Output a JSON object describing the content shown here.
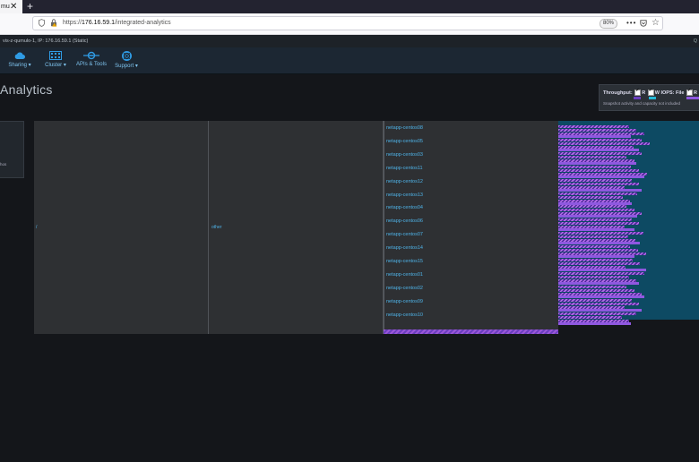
{
  "browser": {
    "tab_title": "mu",
    "close_glyph": "✕",
    "new_tab_glyph": "+",
    "url_prefix": "https://",
    "url_host": "176.16.59.1",
    "url_path": "/integrated-analytics",
    "zoom": "80%",
    "more_glyph": "•••",
    "star_glyph": "☆"
  },
  "status": {
    "host_info": "vis-z-qumulo-1, IP: 176.16.59.1 (Static)",
    "right_text": "Q"
  },
  "nav": [
    {
      "label": "Sharing ▾",
      "icon": "cloud-icon"
    },
    {
      "label": "Cluster ▾",
      "icon": "cluster-icon"
    },
    {
      "label": "APIs & Tools",
      "icon": "api-icon"
    },
    {
      "label": "Support ▾",
      "icon": "lifebuoy-icon"
    }
  ],
  "page_title": "Analytics",
  "legend": {
    "throughput_label": "Throughput:",
    "read_label": "R",
    "write_label": "W",
    "iops_label": "IOPS:",
    "file_label": "File",
    "r_label": "R",
    "note": "Snapshot activity and capacity not included",
    "colors": {
      "read": "#b36ee6",
      "write": "#8f58e0",
      "iops_cyan": "#25b8d6",
      "iops_purple": "#6a3fbf"
    }
  },
  "left_panel": {
    "text": "hos"
  },
  "columns": {
    "root_label": "/",
    "level2_label": "other"
  },
  "hosts": [
    {
      "name": "netapp-centos08",
      "read": 0.62,
      "write": 0.52
    },
    {
      "name": "netapp-centos05",
      "read": 0.66,
      "write": 0.58
    },
    {
      "name": "netapp-centos03",
      "read": 0.6,
      "write": 0.56
    },
    {
      "name": "netapp-centos11",
      "read": 0.64,
      "write": 0.62
    },
    {
      "name": "netapp-centos12",
      "read": 0.58,
      "write": 0.6
    },
    {
      "name": "netapp-centos13",
      "read": 0.57,
      "write": 0.53
    },
    {
      "name": "netapp-centos04",
      "read": 0.6,
      "write": 0.57
    },
    {
      "name": "netapp-centos06",
      "read": 0.58,
      "write": 0.55
    },
    {
      "name": "netapp-centos07",
      "read": 0.61,
      "write": 0.59
    },
    {
      "name": "netapp-centos14",
      "read": 0.63,
      "write": 0.55
    },
    {
      "name": "netapp-centos15",
      "read": 0.59,
      "write": 0.63
    },
    {
      "name": "netapp-centos01",
      "read": 0.62,
      "write": 0.58
    },
    {
      "name": "netapp-centos02",
      "read": 0.6,
      "write": 0.62
    },
    {
      "name": "netapp-centos09",
      "read": 0.58,
      "write": 0.6
    },
    {
      "name": "netapp-centos10",
      "read": 0.56,
      "write": 0.52
    }
  ]
}
